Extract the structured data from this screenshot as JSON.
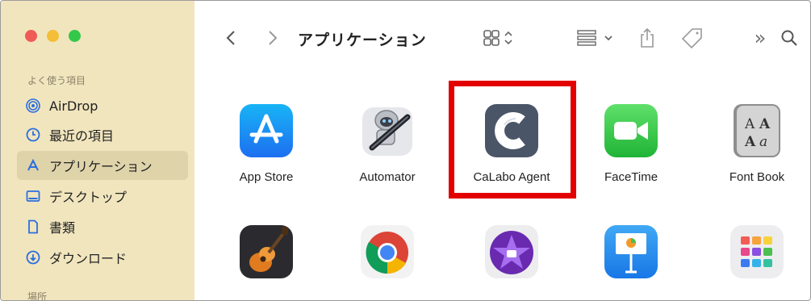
{
  "window": {
    "title": "アプリケーション"
  },
  "sidebar": {
    "section_favorites": "よく使う項目",
    "items": [
      {
        "label": "AirDrop",
        "icon": "airdrop-icon"
      },
      {
        "label": "最近の項目",
        "icon": "clock-icon"
      },
      {
        "label": "アプリケーション",
        "icon": "applications-icon",
        "active": true
      },
      {
        "label": "デスクトップ",
        "icon": "desktop-icon"
      },
      {
        "label": "書類",
        "icon": "document-icon"
      },
      {
        "label": "ダウンロード",
        "icon": "download-icon"
      }
    ],
    "section_locations": "場所"
  },
  "toolbar": {
    "back": "‹",
    "forward": "›",
    "overflow": "»",
    "search": "search-icon"
  },
  "apps": {
    "row1": [
      {
        "label": "App Store"
      },
      {
        "label": "Automator"
      },
      {
        "label": "CaLabo Agent",
        "highlighted": true
      },
      {
        "label": "FaceTime"
      },
      {
        "label": "Font Book"
      }
    ],
    "row2": [
      {
        "label": "GarageBand"
      },
      {
        "label": "Google Chrome"
      },
      {
        "label": "iMovie"
      },
      {
        "label": "Keynote"
      },
      {
        "label": "Launchpad"
      }
    ]
  },
  "colors": {
    "sidebar_bg": "#f1e5be",
    "accent_blue": "#2a6fe0",
    "highlight_red": "#e30000"
  }
}
